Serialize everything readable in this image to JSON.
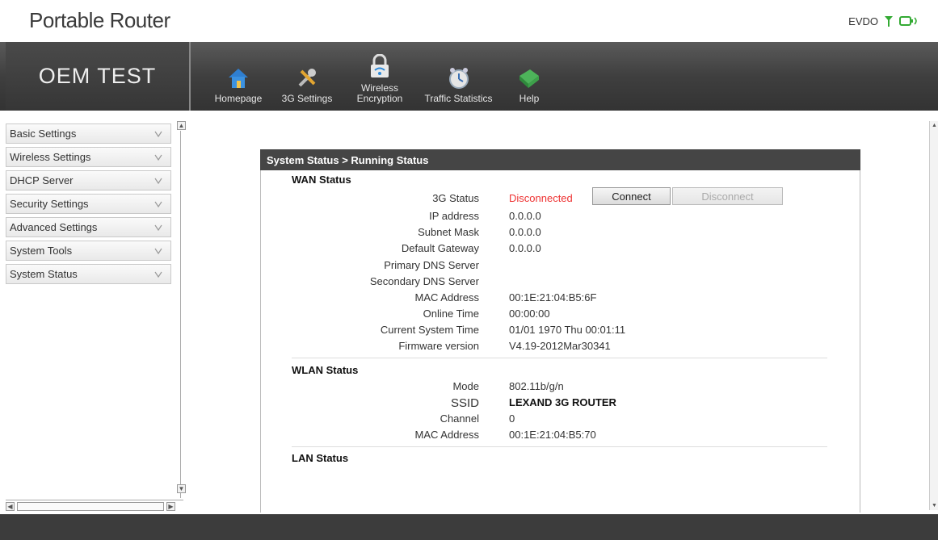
{
  "app": {
    "title": "Portable Router"
  },
  "network": {
    "label": "EVDO"
  },
  "header": {
    "brand": "OEM TEST"
  },
  "nav": [
    {
      "label": "Homepage"
    },
    {
      "label": "3G Settings"
    },
    {
      "label_line1": "Wireless",
      "label_line2": "Encryption"
    },
    {
      "label": "Traffic Statistics"
    },
    {
      "label": "Help"
    }
  ],
  "sidebar": {
    "items": [
      {
        "label": "Basic Settings"
      },
      {
        "label": "Wireless Settings"
      },
      {
        "label": "DHCP Server"
      },
      {
        "label": "Security Settings"
      },
      {
        "label": "Advanced Settings"
      },
      {
        "label": "System Tools"
      },
      {
        "label": "System Status"
      }
    ]
  },
  "panel": {
    "breadcrumb": "System Status > Running Status",
    "wan": {
      "title": "WAN Status",
      "status_label": "3G Status",
      "status_value": "Disconnected",
      "connect_button": "Connect",
      "disconnect_button": "Disconnect",
      "rows": [
        {
          "label": "IP address",
          "value": "0.0.0.0"
        },
        {
          "label": "Subnet Mask",
          "value": "0.0.0.0"
        },
        {
          "label": "Default Gateway",
          "value": "0.0.0.0"
        },
        {
          "label": "Primary DNS Server",
          "value": ""
        },
        {
          "label": "Secondary DNS Server",
          "value": ""
        },
        {
          "label": "MAC Address",
          "value": "00:1E:21:04:B5:6F"
        },
        {
          "label": "Online Time",
          "value": "00:00:00"
        },
        {
          "label": "Current System Time",
          "value": "01/01 1970 Thu 00:01:11"
        },
        {
          "label": "Firmware version",
          "value": "V4.19-2012Mar30341"
        }
      ]
    },
    "wlan": {
      "title": "WLAN Status",
      "rows": [
        {
          "label": "Mode",
          "value": "802.11b/g/n"
        },
        {
          "label": "SSID",
          "value": "LEXAND 3G ROUTER"
        },
        {
          "label": "Channel",
          "value": "0"
        },
        {
          "label": "MAC Address",
          "value": "00:1E:21:04:B5:70"
        }
      ]
    },
    "lan": {
      "title": "LAN Status"
    }
  },
  "colors": {
    "header_bg": "#3f3f3f",
    "status_red": "#e33333",
    "signal_green": "#33aa33"
  }
}
